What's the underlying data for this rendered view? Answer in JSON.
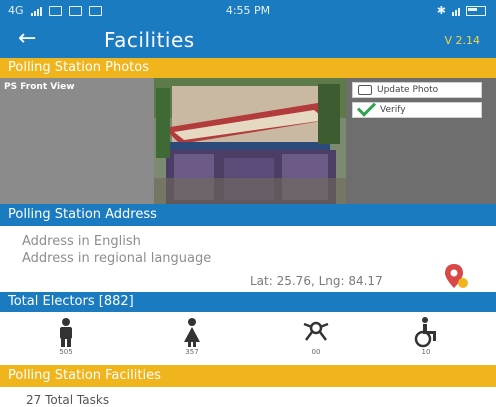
{
  "status_bar": {
    "network": "4G",
    "time": "4:55 PM"
  },
  "app_bar": {
    "back_icon": "arrow-left-icon",
    "title": "Facilities",
    "version": "V 2.14"
  },
  "photos_section": {
    "header": "Polling Station Photos",
    "caption": "PS Front View",
    "update_photo_label": "Update Photo",
    "verify_label": "Verify"
  },
  "address_section": {
    "header": "Polling Station Address",
    "address_english": "Address in English",
    "address_regional": "Address in regional language",
    "latlng": "Lat: 25.76, Lng: 84.17"
  },
  "electors_section": {
    "header": "Total Electors [882]",
    "counts": {
      "male": "505",
      "female": "357",
      "third_gender": "00",
      "pwd": "10"
    }
  },
  "facilities_section": {
    "header": "Polling Station Facilities",
    "total_tasks": "27 Total Tasks"
  },
  "colors": {
    "primary_blue": "#1a7bc0",
    "accent_yellow": "#f0b41c",
    "verify_green": "#2ea44f",
    "pin_red": "#d94848"
  }
}
